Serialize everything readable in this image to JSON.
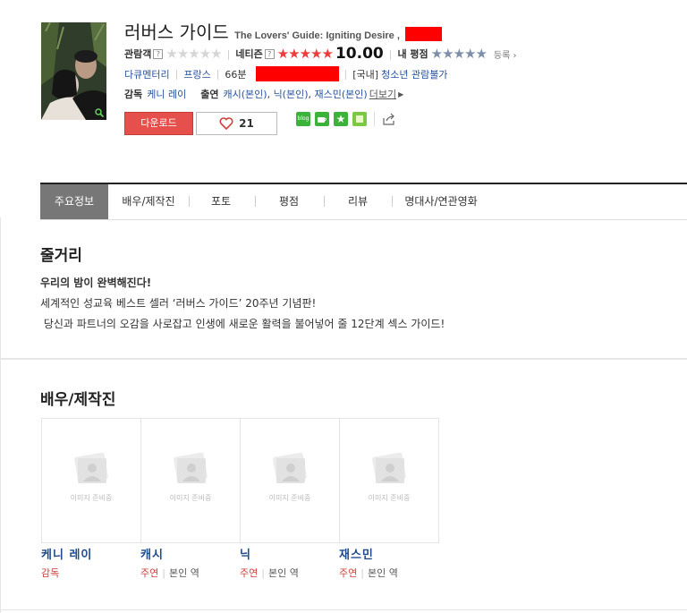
{
  "movie": {
    "title_ko": "러버스 가이드",
    "title_en": "The Lovers' Guide: Igniting Desire ,"
  },
  "ratings": {
    "audience_label": "관람객",
    "netizen_label": "네티즌",
    "netizen_score": "10.00",
    "my_label": "내 평점",
    "register": "등록",
    "help_mark": "?"
  },
  "info": {
    "genre": "다큐멘터리",
    "country": "프랑스",
    "runtime": "66분",
    "grade_prefix": "[국내]",
    "grade": "청소년 관람불가",
    "director_label": "감독",
    "director": "케니 레이",
    "cast_label": "출연",
    "cast": [
      "캐시(본인)",
      "닉(본인)",
      "재스민(본인)"
    ],
    "more": "더보기"
  },
  "actions": {
    "download": "다운로드",
    "like_count": "21",
    "share_icons": [
      "blog-icon",
      "cafe-icon",
      "star-icon",
      "me2day-icon",
      "share-icon"
    ]
  },
  "tabs": [
    "주요정보",
    "배우/제작진",
    "포토",
    "평점",
    "리뷰",
    "명대사/연관영화"
  ],
  "synopsis": {
    "heading": "줄거리",
    "tagline": "우리의 밤이 완벽해진다!",
    "line1": "세계적인 성교육 베스트 셀러 ‘러버스 가이드’ 20주년 기념판!",
    "line2": " 당신과 파트너의 오감을 사로잡고 인생에 새로운 활력을 불어넣어 줄 12단계 섹스 가이드!"
  },
  "cast_section": {
    "heading": "배우/제작진",
    "placeholder": "이미지 준비중",
    "people": [
      {
        "name": "케니 레이",
        "role": "감독",
        "sub": ""
      },
      {
        "name": "캐시",
        "role": "주연",
        "sub": "본인 역"
      },
      {
        "name": "닉",
        "role": "주연",
        "sub": "본인 역"
      },
      {
        "name": "재스민",
        "role": "주연",
        "sub": "본인 역"
      }
    ]
  },
  "colors": {
    "accent_red": "#e5504d",
    "star_red": "#ee3b3b",
    "link_blue": "#2451a3",
    "tab_active": "#777777"
  }
}
